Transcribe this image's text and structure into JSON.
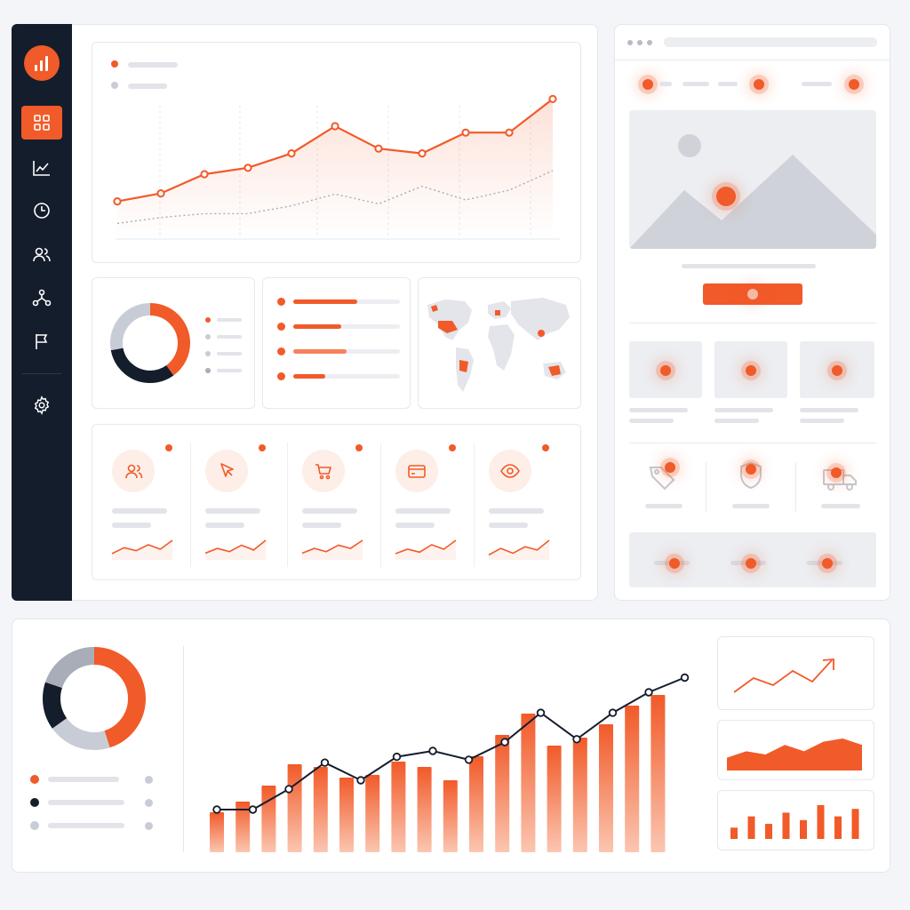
{
  "theme": {
    "accent": "#f15a29",
    "navy": "#141d2c",
    "muted_gray": "#c8ccd6",
    "placeholder": "#e2e4ea"
  },
  "sidebar": {
    "logo_icon": "bar-chart-logo",
    "items": [
      {
        "icon": "dashboard-grid-icon",
        "active": true
      },
      {
        "icon": "line-chart-icon",
        "active": false
      },
      {
        "icon": "clock-icon",
        "active": false
      },
      {
        "icon": "users-icon",
        "active": false
      },
      {
        "icon": "network-icon",
        "active": false
      },
      {
        "icon": "flag-icon",
        "active": false
      }
    ],
    "settings_icon": "gear-icon"
  },
  "top_line_chart": {
    "legend_colors": [
      "#f15a29",
      "#c8ccd6"
    ],
    "primary_series": [
      23,
      28,
      40,
      44,
      53,
      70,
      56,
      53,
      66,
      66,
      87
    ],
    "secondary_series": [
      3,
      6,
      8,
      8,
      12,
      18,
      13,
      22,
      15,
      20,
      30
    ]
  },
  "donut_small": {
    "segments": [
      {
        "value": 40,
        "color": "#f15a29"
      },
      {
        "value": 32,
        "color": "#141d2c"
      },
      {
        "value": 28,
        "color": "#c8ccd6"
      }
    ]
  },
  "progress_list": {
    "items": [
      {
        "fill": 0.6,
        "color": "#f15a29"
      },
      {
        "fill": 0.45,
        "color": "#f15a29"
      },
      {
        "fill": 0.5,
        "color": "#f5825e"
      },
      {
        "fill": 0.3,
        "color": "#f15a29"
      }
    ]
  },
  "world_map": {
    "icon": "world-map"
  },
  "kpi_cards": [
    {
      "icon": "users-icon",
      "trend": [
        3,
        7,
        5,
        9,
        6,
        12
      ]
    },
    {
      "icon": "cursor-icon",
      "trend": [
        3,
        6,
        4,
        8,
        5,
        11
      ]
    },
    {
      "icon": "cart-icon",
      "trend": [
        3,
        6,
        4,
        8,
        6,
        11
      ]
    },
    {
      "icon": "credit-card-icon",
      "trend": [
        3,
        6,
        4,
        9,
        6,
        12
      ]
    },
    {
      "icon": "eye-icon",
      "trend": [
        2,
        6,
        3,
        7,
        5,
        11
      ]
    }
  ],
  "wireframe": {
    "window_dots": 3,
    "hero_icon": "image-placeholder-icon",
    "feature_icons": [
      "tag-icon",
      "shield-icon",
      "truck-icon"
    ]
  },
  "bottom_donut": {
    "segments": [
      {
        "value": 45,
        "color": "#f15a29"
      },
      {
        "value": 20,
        "color": "#c8ccd6"
      },
      {
        "value": 15,
        "color": "#141d2c"
      },
      {
        "value": 20,
        "color": "#a8adb8"
      }
    ]
  },
  "chart_data": {
    "type": "bar",
    "categories": [
      "1",
      "2",
      "3",
      "4",
      "5",
      "6",
      "7",
      "8",
      "9",
      "10",
      "11",
      "12",
      "13",
      "14",
      "15",
      "16",
      "17",
      "18"
    ],
    "series": [
      {
        "type": "bar",
        "values": [
          15,
          19,
          25,
          33,
          32,
          28,
          29,
          34,
          32,
          27,
          36,
          44,
          52,
          40,
          43,
          48,
          55,
          59
        ]
      },
      {
        "type": "line",
        "values": [
          20,
          20,
          27,
          36,
          30,
          38,
          40,
          37,
          43,
          53,
          44,
          53,
          60,
          65
        ]
      }
    ],
    "ylim": [
      0,
      70
    ]
  },
  "mini_charts": {
    "trend_line": [
      2,
      6,
      4,
      8,
      5,
      11
    ],
    "area": [
      4,
      6,
      5,
      8,
      6,
      9,
      10,
      8
    ],
    "mini_bars": [
      3,
      6,
      4,
      7,
      5,
      9,
      6,
      8
    ]
  }
}
